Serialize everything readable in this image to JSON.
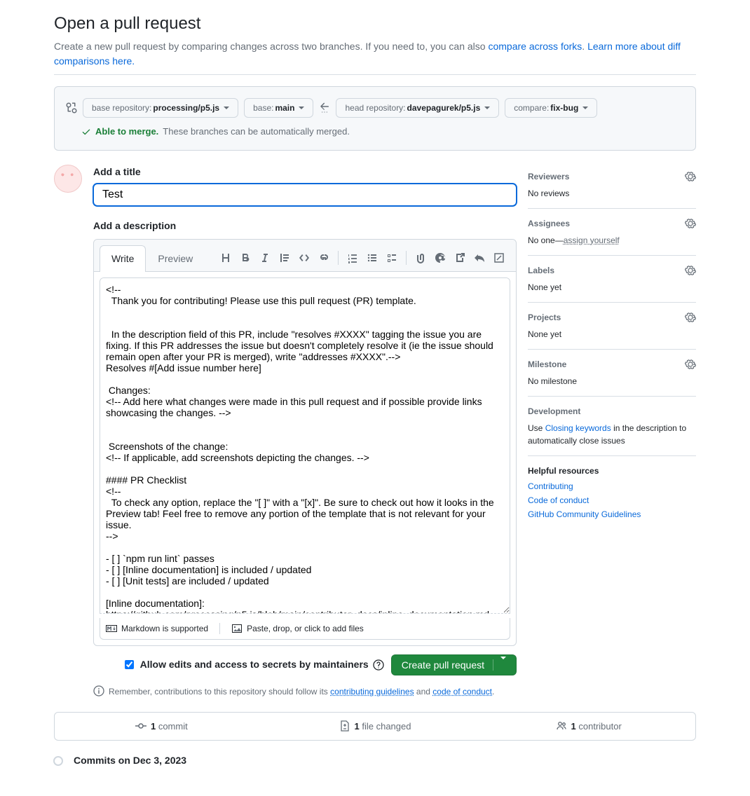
{
  "header": {
    "title": "Open a pull request",
    "subhead_prefix": "Create a new pull request by comparing changes across two branches. If you need to, you can also ",
    "link1": "compare across forks",
    "subhead_mid": ". ",
    "link2": "Learn more about diff comparisons here.",
    "subhead_suffix": ""
  },
  "compare": {
    "base_repo_label": "base repository: ",
    "base_repo": "processing/p5.js",
    "base_branch_label": "base: ",
    "base_branch": "main",
    "head_repo_label": "head repository: ",
    "head_repo": "davepagurek/p5.js",
    "compare_label": "compare: ",
    "compare_branch": "fix-bug",
    "merge_ok": "Able to merge.",
    "merge_msg": "These branches can be automatically merged."
  },
  "form": {
    "title_label": "Add a title",
    "title_value": "Test",
    "desc_label": "Add a description",
    "write_tab": "Write",
    "preview_tab": "Preview",
    "desc_value": "<!--\n  Thank you for contributing! Please use this pull request (PR) template.\n\n\n  In the description field of this PR, include \"resolves #XXXX\" tagging the issue you are fixing. If this PR addresses the issue but doesn't completely resolve it (ie the issue should remain open after your PR is merged), write \"addresses #XXXX\".-->\nResolves #[Add issue number here]\n\n Changes:\n<!-- Add here what changes were made in this pull request and if possible provide links showcasing the changes. -->\n\n\n Screenshots of the change:\n<!-- If applicable, add screenshots depicting the changes. -->\n\n#### PR Checklist\n<!--\n  To check any option, replace the \"[ ]\" with a \"[x]\". Be sure to check out how it looks in the Preview tab! Feel free to remove any portion of the template that is not relevant for your issue.\n-->\n\n- [ ] `npm run lint` passes\n- [ ] [Inline documentation] is included / updated\n- [ ] [Unit tests] are included / updated\n\n[Inline documentation]: https://github.com/processing/p5.js/blob/main/contributor_docs/inline_documentation.md\n[Unit tests]: https://github.com/processing/p5.js/tree/main/contributor_docs#unit-tests",
    "markdown_hint": "Markdown is supported",
    "attach_hint": "Paste, drop, or click to add files",
    "allow_edits": "Allow edits and access to secrets by maintainers",
    "submit": "Create pull request",
    "note_prefix": "Remember, contributions to this repository should follow its ",
    "note_link1": "contributing guidelines",
    "note_mid": " and ",
    "note_link2": "code of conduct",
    "note_suffix": "."
  },
  "sidebar": {
    "reviewers": {
      "head": "Reviewers",
      "body": "No reviews"
    },
    "assignees": {
      "head": "Assignees",
      "body_prefix": "No one—",
      "assign_self": "assign yourself"
    },
    "labels": {
      "head": "Labels",
      "body": "None yet"
    },
    "projects": {
      "head": "Projects",
      "body": "None yet"
    },
    "milestone": {
      "head": "Milestone",
      "body": "No milestone"
    },
    "development": {
      "head": "Development",
      "body_prefix": "Use ",
      "link": "Closing keywords",
      "body_suffix": " in the description to automatically close issues"
    },
    "resources": {
      "head": "Helpful resources",
      "links": [
        "Contributing",
        "Code of conduct",
        "GitHub Community Guidelines"
      ]
    }
  },
  "stats": {
    "commits_n": "1",
    "commits_label": " commit",
    "files_n": "1",
    "files_label": " file changed",
    "contrib_n": "1",
    "contrib_label": " contributor"
  },
  "timeline": {
    "date_heading": "Commits on Dec 3, 2023"
  }
}
